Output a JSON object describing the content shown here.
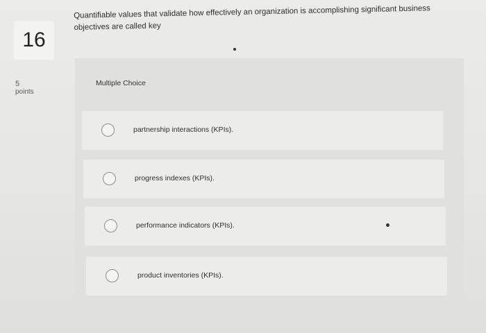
{
  "question": {
    "number": "16",
    "points_value": "5",
    "points_label": "points",
    "text": "Quantifiable values that validate how effectively an organization is accomplishing significant business objectives are called key",
    "type": "Multiple Choice",
    "options": [
      {
        "label": "partnership interactions (KPIs).",
        "selected": false
      },
      {
        "label": "progress indexes (KPIs).",
        "selected": false
      },
      {
        "label": "performance indicators (KPIs).",
        "selected": false
      },
      {
        "label": "product inventories (KPIs).",
        "selected": false
      }
    ]
  }
}
